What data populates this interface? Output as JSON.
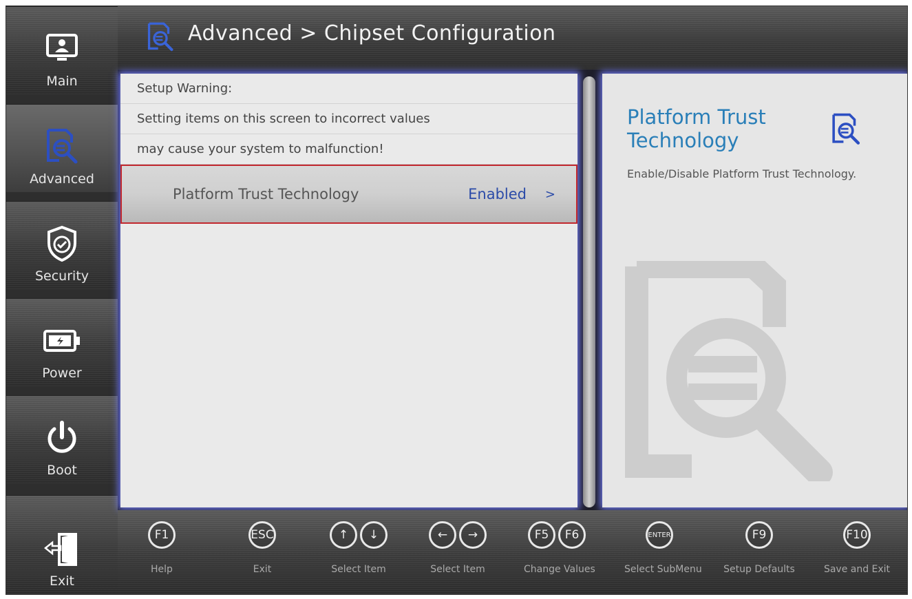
{
  "header": {
    "title": "Advanced > Chipset Configuration",
    "icon": "advanced-doc-icon"
  },
  "sidebar": {
    "items": [
      {
        "label": "Main",
        "icon": "monitor-user-icon"
      },
      {
        "label": "Advanced",
        "icon": "advanced-doc-icon",
        "active": true
      },
      {
        "label": "Security",
        "icon": "shield-check-icon"
      },
      {
        "label": "Power",
        "icon": "battery-icon"
      },
      {
        "label": "Boot",
        "icon": "power-icon"
      },
      {
        "label": "Exit",
        "icon": "exit-door-icon"
      }
    ]
  },
  "main": {
    "warning_lines": [
      "Setup Warning:",
      "Setting items on this screen to incorrect values",
      "may cause your system to malfunction!"
    ],
    "selected_item": {
      "label": "Platform Trust Technology",
      "value": "Enabled",
      "arrow": ">"
    }
  },
  "help": {
    "title": "Platform Trust Technology",
    "description": "Enable/Disable Platform Trust Technology."
  },
  "footer": {
    "keys": [
      {
        "keys": [
          "F1"
        ],
        "label": "Help"
      },
      {
        "keys": [
          "ESC"
        ],
        "label": "Exit"
      },
      {
        "keys": [
          "↑",
          "↓"
        ],
        "label": "Select Item"
      },
      {
        "keys": [
          "←",
          "→"
        ],
        "label": "Select Item"
      },
      {
        "keys": [
          "F5",
          "F6"
        ],
        "label": "Change Values"
      },
      {
        "keys": [
          "ENTER"
        ],
        "label": "Select SubMenu"
      },
      {
        "keys": [
          "F9"
        ],
        "label": "Setup Defaults"
      },
      {
        "keys": [
          "F10"
        ],
        "label": "Save and Exit"
      }
    ]
  },
  "colors": {
    "accent": "#2b4ba8",
    "help_title": "#2a7fb8",
    "selection_border": "#c1272d",
    "glow": "#7882ff"
  }
}
